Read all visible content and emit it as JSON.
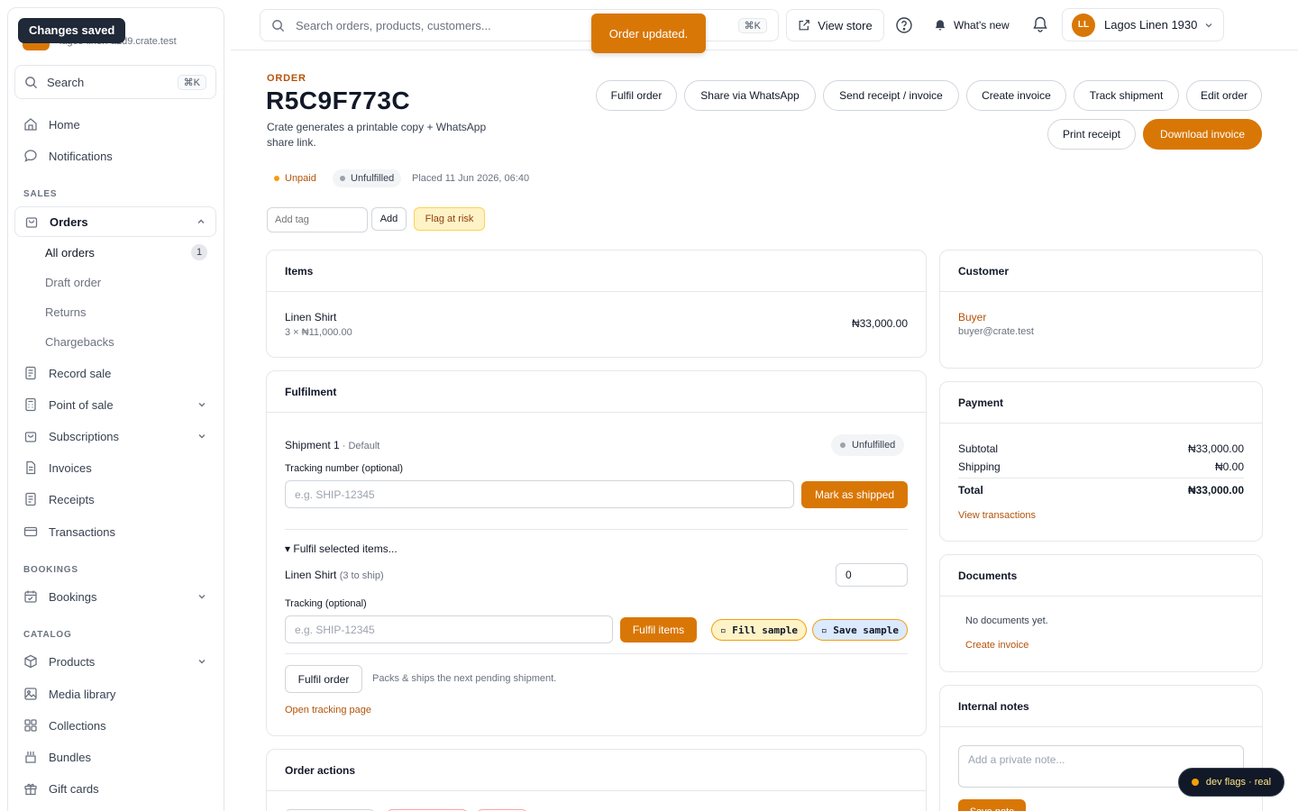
{
  "sidebar": {
    "toast": "Changes saved",
    "store_domain": "lagos-linen-a2d9.crate.test",
    "search_label": "Search",
    "search_kbd": "⌘K",
    "items": {
      "home": "Home",
      "notifications": "Notifications",
      "sales_section": "SALES",
      "orders": "Orders",
      "all_orders": "All orders",
      "all_orders_count": "1",
      "draft_order": "Draft order",
      "returns": "Returns",
      "chargebacks": "Chargebacks",
      "record_sale": "Record sale",
      "point_of_sale": "Point of sale",
      "subscriptions": "Subscriptions",
      "invoices": "Invoices",
      "receipts": "Receipts",
      "transactions": "Transactions",
      "bookings_section": "BOOKINGS",
      "bookings": "Bookings",
      "catalog_section": "CATALOG",
      "products": "Products",
      "media_library": "Media library",
      "collections": "Collections",
      "bundles": "Bundles",
      "gift_cards": "Gift cards"
    }
  },
  "topbar": {
    "search_placeholder": "Search orders, products, customers...",
    "search_kbd": "⌘K",
    "toast": "Order updated.",
    "view_store": "View store",
    "whats_new": "What's new",
    "avatar_initials": "LL",
    "account_name": "Lagos Linen 1930"
  },
  "order": {
    "kicker": "ORDER",
    "id": "R5C9F773C",
    "description": "Crate generates a printable copy + WhatsApp share link.",
    "actions": {
      "fulfil": "Fulfil order",
      "share_whatsapp": "Share via WhatsApp",
      "send_receipt": "Send receipt / invoice",
      "create_invoice": "Create invoice",
      "track_shipment": "Track shipment",
      "edit_order": "Edit order",
      "print_receipt": "Print receipt",
      "download_invoice": "Download invoice"
    },
    "status": {
      "payment": "Unpaid",
      "fulfilment": "Unfulfilled",
      "placed": "Placed 11 Jun 2026, 06:40"
    },
    "tags": {
      "placeholder": "Add tag",
      "add_label": "Add",
      "flag_label": "Flag at risk"
    }
  },
  "items_card": {
    "title": "Items",
    "line": {
      "name": "Linen Shirt",
      "detail": "3 × ₦11,000.00",
      "total": "₦33,000.00"
    }
  },
  "fulfilment_card": {
    "title": "Fulfilment",
    "shipment_title": "Shipment 1",
    "shipment_sub": " · Default",
    "shipment_status": "Unfulfilled",
    "tracking_label": "Tracking number (optional)",
    "tracking_placeholder": "e.g. SHIP-12345",
    "mark_shipped": "Mark as shipped",
    "fulfil_selected": "▾ Fulfil selected items...",
    "item_name": "Linen Shirt",
    "item_to_ship": "(3 to ship)",
    "item_qty": "0",
    "tracking2_label": "Tracking (optional)",
    "tracking2_placeholder": "e.g. SHIP-12345",
    "fulfil_items": "Fulfil items",
    "fill_sample": "▫ Fill sample",
    "save_sample": "▫ Save sample",
    "fulfil_order": "Fulfil order",
    "fulfil_order_hint": "Packs & ships the next pending shipment.",
    "open_tracking": "Open tracking page"
  },
  "order_actions_card": {
    "title": "Order actions"
  },
  "customer_card": {
    "title": "Customer",
    "name": "Buyer",
    "email": "buyer@crate.test"
  },
  "payment_card": {
    "title": "Payment",
    "subtotal_label": "Subtotal",
    "subtotal_value": "₦33,000.00",
    "shipping_label": "Shipping",
    "shipping_value": "₦0.00",
    "total_label": "Total",
    "total_value": "₦33,000.00",
    "view_transactions": "View transactions"
  },
  "documents_card": {
    "title": "Documents",
    "empty": "No documents yet.",
    "create_invoice": "Create invoice"
  },
  "notes_card": {
    "title": "Internal notes",
    "placeholder": "Add a private note...",
    "save_label": "Save note"
  },
  "dev_flags": "dev flags · real",
  "colors": {
    "accent": "#d97706",
    "accent_text": "#b45309",
    "border": "#e5e7eb"
  }
}
